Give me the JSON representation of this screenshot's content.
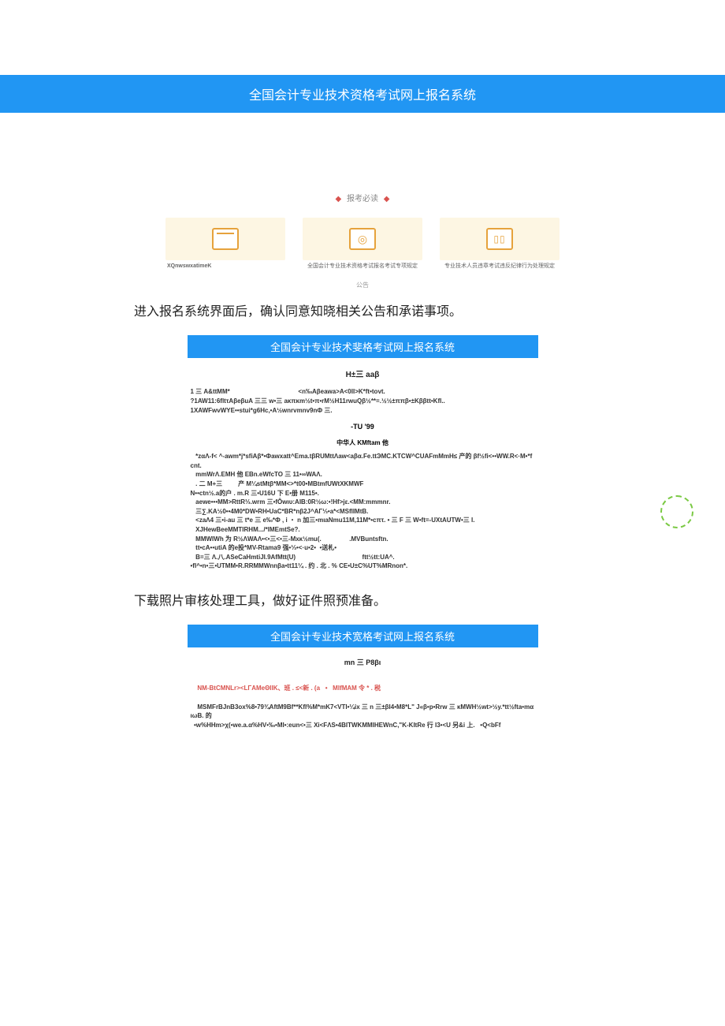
{
  "banner_title": "全国会计专业技术资格考试网上报名系统",
  "must_read_label": "报考必读",
  "cards": [
    {
      "caption": "XQnwswxatimeK",
      "sub": ""
    },
    {
      "caption": "",
      "sub": "全国会计专业技术资格考试报名考试专项规定"
    },
    {
      "caption": "",
      "sub": "专业技术人员违章考试违反纪律行为处理规定"
    }
  ],
  "gonggao": "公告",
  "step1_instruction": "进入报名系统界面后，确认同意知晓相关公告和承诺事项。",
  "block1_header": "全国会计专业技术斐格考试网上报名系统",
  "block1_subtitle": "H±三 aaβ",
  "block1_para1": "1 三 A&ttMM*                                       <n‰Aβeawa>A<0II>K*ft•tovt.\n?1AW11:6fltτAβeβuA 三三 w•三 aκπκm½t•π•rM½H11rwuQβ½**=.½½±ππβ•±Kββtt•Kfl..\n1XAWFwvWYE••stui*g6Hc,•A½wnrvmnv9nФ 三.",
  "block1_center": "-TU   '99",
  "block1_center2": "中华人 KMftam 他",
  "block1_para2": "   *zαΛ-f< ^-awm*j*sfiAβ*•Фawxatt^Ema.tβRUMttΛaw<aβα.Fe.ttЭMC.KTCW^CUAFmMmH≤ 产的 βf½fi<••WW.R<·M•*fcnt.\n   mmWrΛ.EMH 他 EBn.eWfcTO 三 11•∞WAΛ.\n   . 二 M+三         产 M¼stMtβ*MM<>*t00•MBtmfUWtXKMWF\nN••ctn½.a的户 . m.R 三•U16U 下 E•册 M115•.\n   aewe•••MM>RttR⅓.wrm 三•fÔwιυ:AIB:0R½ω:•!Hf>jε.<MM:mmmnr.\n   三∑.KA½0••4M0*DW•RH•UaC*BR*nβ2J^AΓ⅓•a*<MSflIMtB.\n   <zaΛ4 三•i-au 三 t*e 三 e‰*Ф , i ・ n 加三•mιaNmu11M,11M*•cπτ. • 三 F 三 W•ft=-UXtAUTW•三 I.\n   XJHewBeeMMTIRHM.../*IMEmtSe?.\n   MMWIWh 为 R½ΛWAΛ•<•三<•三-Mxκ½mu(.                .MVBuntsftn.\n   tt•cA••utiA 的e投*MV-Rtama9 强•⅓•<·u•2•  •送札•\n   B=三 Λ.八.ASeCaHmtiJI.9AfMtt(U)                                      ftt½tt:UA^.\n•fI^•n•三•UTMM•R.RRMMWnnβa•tt11¼ . 约 . 北 . % CE•U±C%UT%MRnon*.",
  "step2_instruction": "下载照片审核处理工具，做好证件照预准备。",
  "block2_header": "全国会计专业技术宽格考试网上报名系统",
  "block2_subtitle": "mn 三 P8βι",
  "block2_redline": "NM-BtCMNLr><LΓAMeΘIIK、班 . ≤<新 . (a   •   MIfMAM 令 * . 税",
  "block2_body": "MSMFrBJnB3ox%8•79¾AftM9Bf**Kfl%M*mK7<VTI•¼ix 三 n 三±βI4•M8*L\" J«β•p•Rrw 三 κMWH½wt>½y.*tt½fta•mαιωB. 的\n  •w%HHm>χ(•we.a.α%HV•‰•MI•:eun<•三 Xi<FΛS•4BITWKMMIHEWnC,\"K-KItRe 行 I3•<U 另&i 上.   •Q<bFf",
  "badge_label": ""
}
